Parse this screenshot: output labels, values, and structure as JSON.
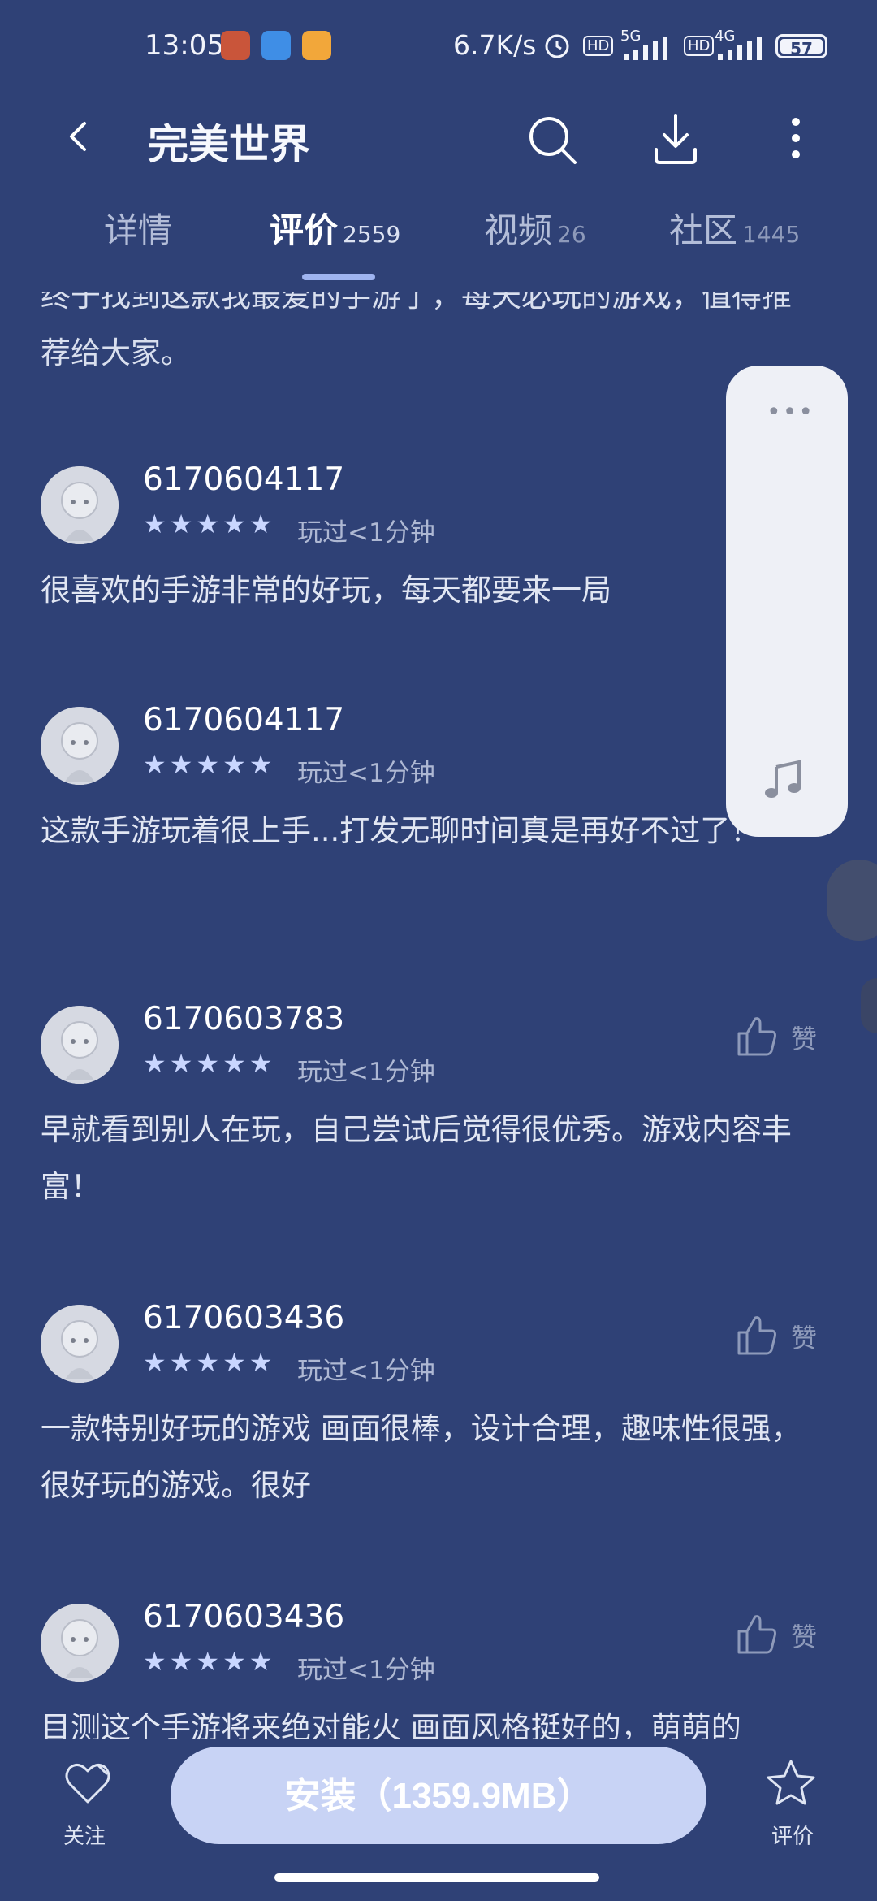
{
  "status_bar": {
    "time": "13:05",
    "speed": "6.7K/s",
    "net1": "5G",
    "net2": "4G",
    "hd": "HD",
    "battery": "57"
  },
  "header": {
    "title": "完美世界"
  },
  "tabs": [
    {
      "label": "详情",
      "count": ""
    },
    {
      "label": "评价",
      "count": "2559"
    },
    {
      "label": "视频",
      "count": "26"
    },
    {
      "label": "社区",
      "count": "1445"
    }
  ],
  "reviews": {
    "prev_text": "终于找到这款我最爱的手游了，每天必玩的游戏，值得推荐给大家。",
    "items": [
      {
        "user": "6170604117",
        "stars": "★★★★★",
        "played": "玩过<1分钟",
        "text": "很喜欢的手游非常的好玩，每天都要来一局",
        "like": ""
      },
      {
        "user": "6170604117",
        "stars": "★★★★★",
        "played": "玩过<1分钟",
        "text": "这款手游玩着很上手...打发无聊时间真是再好不过了！",
        "like": ""
      },
      {
        "user": "6170603783",
        "stars": "★★★★★",
        "played": "玩过<1分钟",
        "text": "早就看到别人在玩，自己尝试后觉得很优秀。游戏内容丰富！",
        "like": "赞"
      },
      {
        "user": "6170603436",
        "stars": "★★★★★",
        "played": "玩过<1分钟",
        "text": "一款特别好玩的游戏 画面很棒，设计合理，趣味性很强，很好玩的游戏。很好",
        "like": "赞"
      },
      {
        "user": "6170603436",
        "stars": "★★★★★",
        "played": "玩过<1分钟",
        "text": "目测这个手游将来绝对能火 画面风格挺好的，萌萌的",
        "like": "赞"
      }
    ]
  },
  "float_panel": {
    "dots": "•••"
  },
  "bottom_bar": {
    "follow_label": "关注",
    "install_label": "安装（1359.9MB）",
    "rate_label": "评价"
  },
  "colors": {
    "background": "#2f4176",
    "install_button": "#c8d3f5",
    "star": "#c9d6ff"
  }
}
